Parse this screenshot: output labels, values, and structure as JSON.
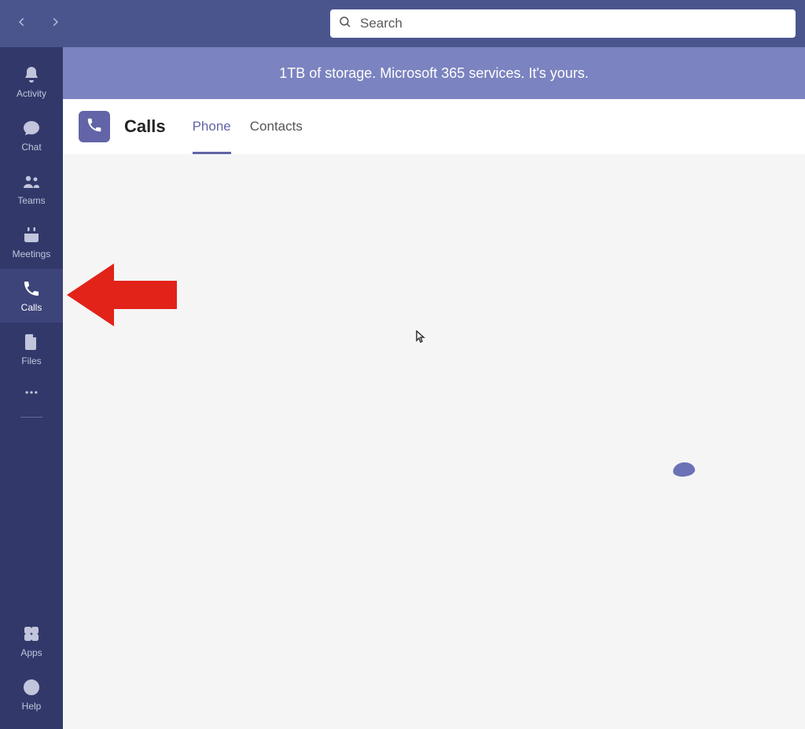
{
  "search": {
    "placeholder": "Search"
  },
  "sidebar": {
    "items": [
      {
        "label": "Activity"
      },
      {
        "label": "Chat"
      },
      {
        "label": "Teams"
      },
      {
        "label": "Meetings"
      },
      {
        "label": "Calls"
      },
      {
        "label": "Files"
      }
    ],
    "bottom": [
      {
        "label": "Apps"
      },
      {
        "label": "Help"
      }
    ]
  },
  "banner": {
    "text": "1TB of storage. Microsoft 365 services. It's yours."
  },
  "page": {
    "title": "Calls",
    "tabs": [
      {
        "label": "Phone",
        "active": true
      },
      {
        "label": "Contacts",
        "active": false
      }
    ]
  },
  "annotation": {
    "arrow_color": "#e2231a"
  }
}
